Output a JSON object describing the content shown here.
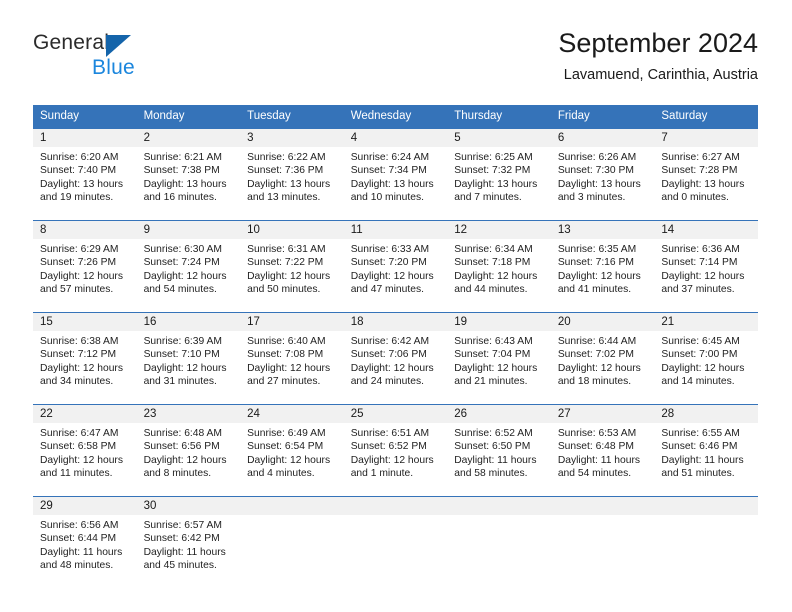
{
  "brand": {
    "name_top": "General",
    "name_bottom": "Blue",
    "accent_color": "#1b86dd",
    "triangle_color": "#1464aa"
  },
  "header": {
    "title": "September 2024",
    "subtitle": "Lavamuend, Carinthia, Austria"
  },
  "theme": {
    "header_row_bg": "#3573b9",
    "header_row_text": "#ffffff",
    "day_band_bg": "#f1f1f1",
    "separator": "#3573b9"
  },
  "weekdays": [
    "Sunday",
    "Monday",
    "Tuesday",
    "Wednesday",
    "Thursday",
    "Friday",
    "Saturday"
  ],
  "weeks": [
    [
      {
        "day": "1",
        "sunrise": "Sunrise: 6:20 AM",
        "sunset": "Sunset: 7:40 PM",
        "daylight_1": "Daylight: 13 hours",
        "daylight_2": "and 19 minutes."
      },
      {
        "day": "2",
        "sunrise": "Sunrise: 6:21 AM",
        "sunset": "Sunset: 7:38 PM",
        "daylight_1": "Daylight: 13 hours",
        "daylight_2": "and 16 minutes."
      },
      {
        "day": "3",
        "sunrise": "Sunrise: 6:22 AM",
        "sunset": "Sunset: 7:36 PM",
        "daylight_1": "Daylight: 13 hours",
        "daylight_2": "and 13 minutes."
      },
      {
        "day": "4",
        "sunrise": "Sunrise: 6:24 AM",
        "sunset": "Sunset: 7:34 PM",
        "daylight_1": "Daylight: 13 hours",
        "daylight_2": "and 10 minutes."
      },
      {
        "day": "5",
        "sunrise": "Sunrise: 6:25 AM",
        "sunset": "Sunset: 7:32 PM",
        "daylight_1": "Daylight: 13 hours",
        "daylight_2": "and 7 minutes."
      },
      {
        "day": "6",
        "sunrise": "Sunrise: 6:26 AM",
        "sunset": "Sunset: 7:30 PM",
        "daylight_1": "Daylight: 13 hours",
        "daylight_2": "and 3 minutes."
      },
      {
        "day": "7",
        "sunrise": "Sunrise: 6:27 AM",
        "sunset": "Sunset: 7:28 PM",
        "daylight_1": "Daylight: 13 hours",
        "daylight_2": "and 0 minutes."
      }
    ],
    [
      {
        "day": "8",
        "sunrise": "Sunrise: 6:29 AM",
        "sunset": "Sunset: 7:26 PM",
        "daylight_1": "Daylight: 12 hours",
        "daylight_2": "and 57 minutes."
      },
      {
        "day": "9",
        "sunrise": "Sunrise: 6:30 AM",
        "sunset": "Sunset: 7:24 PM",
        "daylight_1": "Daylight: 12 hours",
        "daylight_2": "and 54 minutes."
      },
      {
        "day": "10",
        "sunrise": "Sunrise: 6:31 AM",
        "sunset": "Sunset: 7:22 PM",
        "daylight_1": "Daylight: 12 hours",
        "daylight_2": "and 50 minutes."
      },
      {
        "day": "11",
        "sunrise": "Sunrise: 6:33 AM",
        "sunset": "Sunset: 7:20 PM",
        "daylight_1": "Daylight: 12 hours",
        "daylight_2": "and 47 minutes."
      },
      {
        "day": "12",
        "sunrise": "Sunrise: 6:34 AM",
        "sunset": "Sunset: 7:18 PM",
        "daylight_1": "Daylight: 12 hours",
        "daylight_2": "and 44 minutes."
      },
      {
        "day": "13",
        "sunrise": "Sunrise: 6:35 AM",
        "sunset": "Sunset: 7:16 PM",
        "daylight_1": "Daylight: 12 hours",
        "daylight_2": "and 41 minutes."
      },
      {
        "day": "14",
        "sunrise": "Sunrise: 6:36 AM",
        "sunset": "Sunset: 7:14 PM",
        "daylight_1": "Daylight: 12 hours",
        "daylight_2": "and 37 minutes."
      }
    ],
    [
      {
        "day": "15",
        "sunrise": "Sunrise: 6:38 AM",
        "sunset": "Sunset: 7:12 PM",
        "daylight_1": "Daylight: 12 hours",
        "daylight_2": "and 34 minutes."
      },
      {
        "day": "16",
        "sunrise": "Sunrise: 6:39 AM",
        "sunset": "Sunset: 7:10 PM",
        "daylight_1": "Daylight: 12 hours",
        "daylight_2": "and 31 minutes."
      },
      {
        "day": "17",
        "sunrise": "Sunrise: 6:40 AM",
        "sunset": "Sunset: 7:08 PM",
        "daylight_1": "Daylight: 12 hours",
        "daylight_2": "and 27 minutes."
      },
      {
        "day": "18",
        "sunrise": "Sunrise: 6:42 AM",
        "sunset": "Sunset: 7:06 PM",
        "daylight_1": "Daylight: 12 hours",
        "daylight_2": "and 24 minutes."
      },
      {
        "day": "19",
        "sunrise": "Sunrise: 6:43 AM",
        "sunset": "Sunset: 7:04 PM",
        "daylight_1": "Daylight: 12 hours",
        "daylight_2": "and 21 minutes."
      },
      {
        "day": "20",
        "sunrise": "Sunrise: 6:44 AM",
        "sunset": "Sunset: 7:02 PM",
        "daylight_1": "Daylight: 12 hours",
        "daylight_2": "and 18 minutes."
      },
      {
        "day": "21",
        "sunrise": "Sunrise: 6:45 AM",
        "sunset": "Sunset: 7:00 PM",
        "daylight_1": "Daylight: 12 hours",
        "daylight_2": "and 14 minutes."
      }
    ],
    [
      {
        "day": "22",
        "sunrise": "Sunrise: 6:47 AM",
        "sunset": "Sunset: 6:58 PM",
        "daylight_1": "Daylight: 12 hours",
        "daylight_2": "and 11 minutes."
      },
      {
        "day": "23",
        "sunrise": "Sunrise: 6:48 AM",
        "sunset": "Sunset: 6:56 PM",
        "daylight_1": "Daylight: 12 hours",
        "daylight_2": "and 8 minutes."
      },
      {
        "day": "24",
        "sunrise": "Sunrise: 6:49 AM",
        "sunset": "Sunset: 6:54 PM",
        "daylight_1": "Daylight: 12 hours",
        "daylight_2": "and 4 minutes."
      },
      {
        "day": "25",
        "sunrise": "Sunrise: 6:51 AM",
        "sunset": "Sunset: 6:52 PM",
        "daylight_1": "Daylight: 12 hours",
        "daylight_2": "and 1 minute."
      },
      {
        "day": "26",
        "sunrise": "Sunrise: 6:52 AM",
        "sunset": "Sunset: 6:50 PM",
        "daylight_1": "Daylight: 11 hours",
        "daylight_2": "and 58 minutes."
      },
      {
        "day": "27",
        "sunrise": "Sunrise: 6:53 AM",
        "sunset": "Sunset: 6:48 PM",
        "daylight_1": "Daylight: 11 hours",
        "daylight_2": "and 54 minutes."
      },
      {
        "day": "28",
        "sunrise": "Sunrise: 6:55 AM",
        "sunset": "Sunset: 6:46 PM",
        "daylight_1": "Daylight: 11 hours",
        "daylight_2": "and 51 minutes."
      }
    ],
    [
      {
        "day": "29",
        "sunrise": "Sunrise: 6:56 AM",
        "sunset": "Sunset: 6:44 PM",
        "daylight_1": "Daylight: 11 hours",
        "daylight_2": "and 48 minutes."
      },
      {
        "day": "30",
        "sunrise": "Sunrise: 6:57 AM",
        "sunset": "Sunset: 6:42 PM",
        "daylight_1": "Daylight: 11 hours",
        "daylight_2": "and 45 minutes."
      },
      {
        "day": "",
        "sunrise": "",
        "sunset": "",
        "daylight_1": "",
        "daylight_2": ""
      },
      {
        "day": "",
        "sunrise": "",
        "sunset": "",
        "daylight_1": "",
        "daylight_2": ""
      },
      {
        "day": "",
        "sunrise": "",
        "sunset": "",
        "daylight_1": "",
        "daylight_2": ""
      },
      {
        "day": "",
        "sunrise": "",
        "sunset": "",
        "daylight_1": "",
        "daylight_2": ""
      },
      {
        "day": "",
        "sunrise": "",
        "sunset": "",
        "daylight_1": "",
        "daylight_2": ""
      }
    ]
  ]
}
